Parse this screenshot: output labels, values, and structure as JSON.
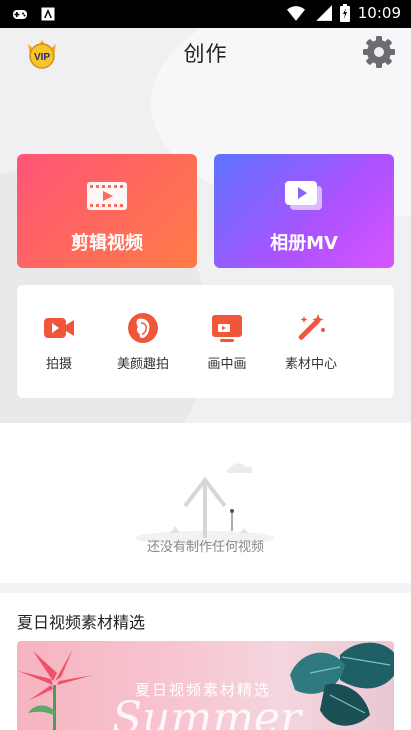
{
  "status_bar": {
    "time": "10:09",
    "left_icons": [
      "gamepad-icon",
      "store-icon"
    ],
    "right_icons": [
      "wifi-icon",
      "signal-icon",
      "battery-icon"
    ]
  },
  "title_bar": {
    "title": "创作",
    "vip_badge": "VIP"
  },
  "main_actions": [
    {
      "label": "剪辑视频",
      "icon": "film-icon",
      "gradient": [
        "#ff5477",
        "#ff7c45"
      ]
    },
    {
      "label": "相册MV",
      "icon": "album-play-icon",
      "gradient": [
        "#5d73ff",
        "#d954ff"
      ]
    }
  ],
  "tools": [
    {
      "label": "拍摄",
      "icon": "video-camera-icon",
      "color": "#f0573a"
    },
    {
      "label": "美颜趣拍",
      "icon": "face-beauty-icon",
      "color": "#f0573a"
    },
    {
      "label": "画中画",
      "icon": "picture-in-picture-icon",
      "color": "#f0573a"
    },
    {
      "label": "素材中心",
      "icon": "magic-wand-icon",
      "color": "#f0573a"
    }
  ],
  "empty_state": {
    "message": "还没有制作任何视频"
  },
  "featured": {
    "section_title": "夏日视频素材精选",
    "banner_title": "夏日视频素材精选",
    "banner_script": "Summer"
  }
}
